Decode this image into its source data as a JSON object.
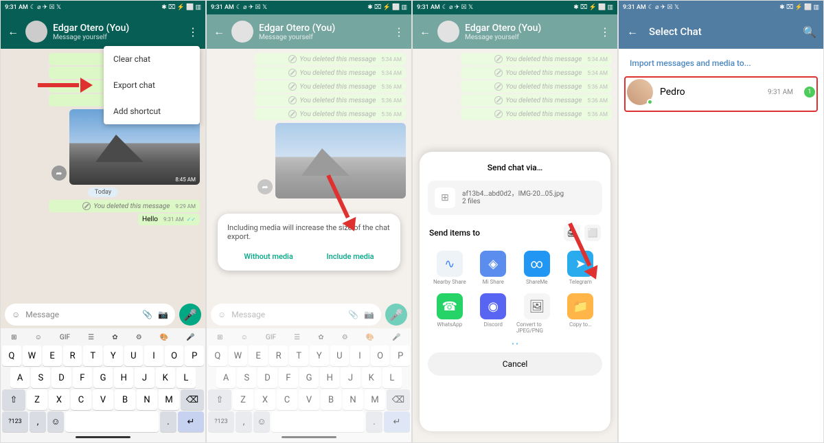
{
  "status": {
    "time": "9:31 AM",
    "left_icons": "☾ ⌀ ✈ ☒ 𝕏",
    "right_icons": "✱ ⌧ ⚡ ⬜ ▥"
  },
  "wa_header": {
    "name": "Edgar Otero (You)",
    "subtitle": "Message yourself"
  },
  "deleted_msgs": [
    {
      "text": "You deleted this message",
      "time": "5:34 AM"
    },
    {
      "text": "You deleted this message",
      "time": "5:34 AM"
    },
    {
      "text": "You deleted this message",
      "time": "5:36 AM"
    },
    {
      "text": "You deleted this message",
      "time": "5:36 AM"
    },
    {
      "text": "You deleted this message",
      "time": "5:36 AM"
    }
  ],
  "img_time": "8:45 AM",
  "today_label": "Today",
  "recent_deleted": {
    "text": "You deleted this message",
    "time": "9:29 AM"
  },
  "hello": {
    "text": "Hello",
    "time": "9:31 AM"
  },
  "input": {
    "placeholder": "Message",
    "emoji": "☺",
    "attach": "📎",
    "camera": "📷"
  },
  "dropdown": {
    "clear": "Clear chat",
    "export": "Export chat",
    "shortcut": "Add shortcut"
  },
  "keyboard": {
    "tools": [
      "⊞",
      "☺",
      "GIF",
      "☰",
      "✿",
      "⚙",
      "🎨",
      "🎤"
    ],
    "r1": [
      "Q",
      "W",
      "E",
      "R",
      "T",
      "Y",
      "U",
      "I",
      "O",
      "P"
    ],
    "r2": [
      "A",
      "S",
      "D",
      "F",
      "G",
      "H",
      "J",
      "K",
      "L"
    ],
    "r3": [
      "⇧",
      "Z",
      "X",
      "C",
      "V",
      "B",
      "N",
      "M",
      "⌫"
    ],
    "r4": [
      "?123",
      ",",
      "☺",
      " ",
      ".",
      "↵"
    ]
  },
  "dialog": {
    "text": "Including media will increase the size of the chat export.",
    "without": "Without media",
    "include": "Include media"
  },
  "share": {
    "title": "Send chat via…",
    "file_line": "af13b4…abd0d2，IMG-20…05.jpg",
    "file_count": "2 files",
    "send_to": "Send items to",
    "apps": [
      {
        "name": "Nearby Share",
        "color": "#EEF3F8",
        "icon": "∿",
        "txtc": "#4285F4"
      },
      {
        "name": "Mi Share",
        "color": "#5B8DEF",
        "icon": "◈"
      },
      {
        "name": "ShareMe",
        "color": "#2196F3",
        "icon": "∞"
      },
      {
        "name": "Telegram",
        "color": "#2AABEE",
        "icon": "➤"
      },
      {
        "name": "WhatsApp",
        "color": "#25D366",
        "icon": "☎"
      },
      {
        "name": "Discord",
        "color": "#5865F2",
        "icon": "◉"
      },
      {
        "name": "Convert to JPEG/PNG",
        "color": "#F5F5F5",
        "icon": "🖼",
        "txtc": "#666"
      },
      {
        "name": "Copy to…",
        "color": "#FFB547",
        "icon": "📁"
      }
    ],
    "cancel": "Cancel"
  },
  "tg": {
    "title": "Select Chat",
    "import": "Import messages and media to...",
    "chat": {
      "name": "Pedro",
      "time": "9:31 AM",
      "unread": "1"
    }
  }
}
